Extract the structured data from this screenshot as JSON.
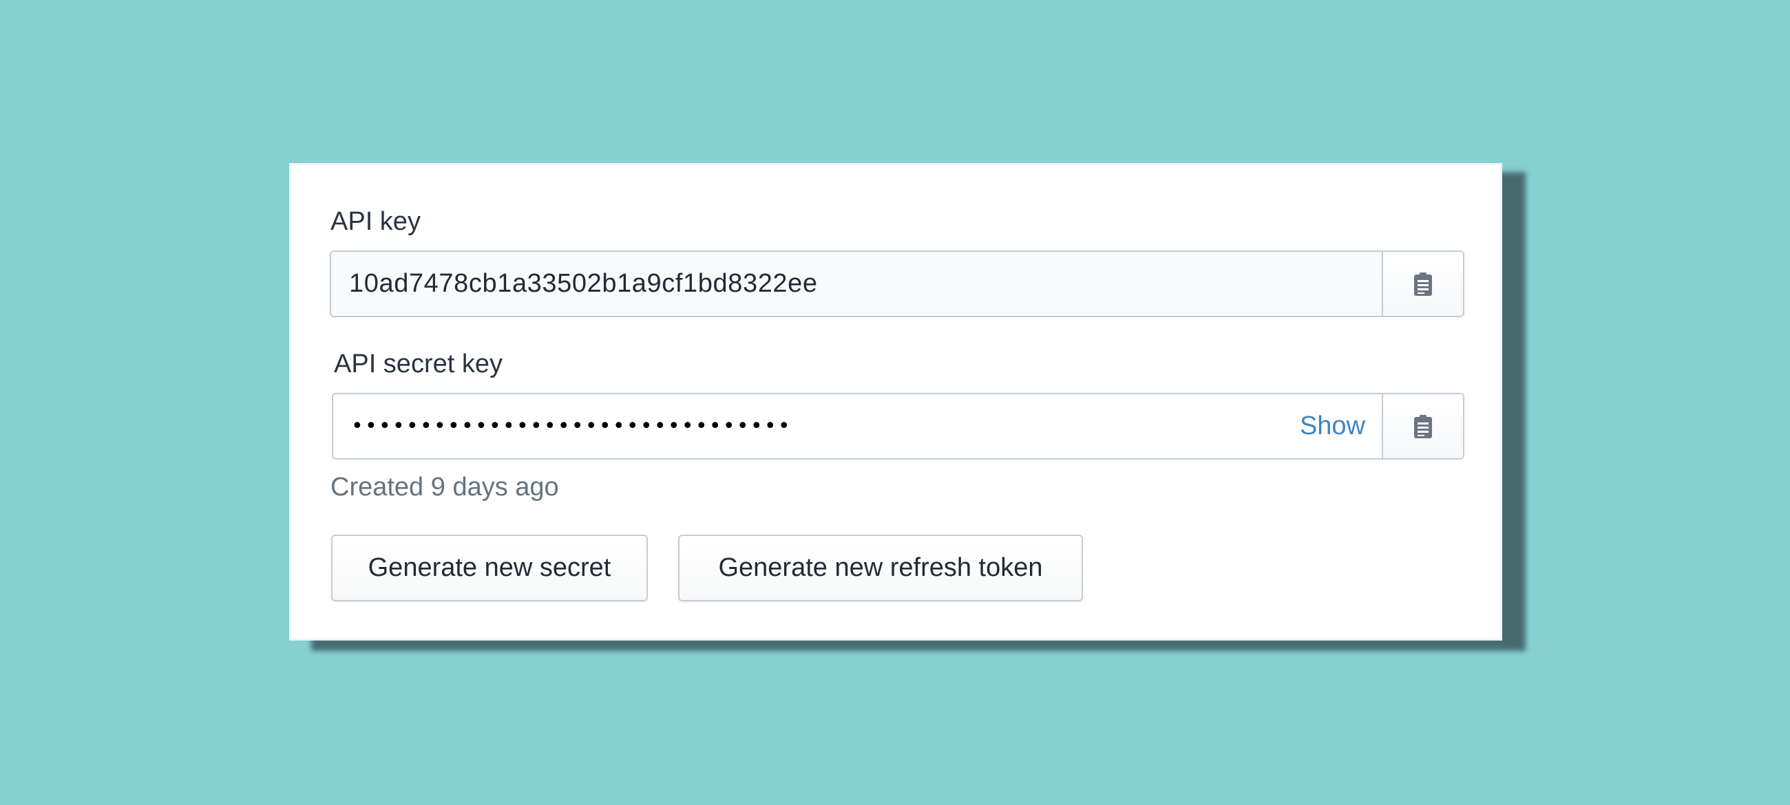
{
  "api_key": {
    "label": "API key",
    "value": "10ad7478cb1a33502b1a9cf1bd8322ee",
    "copy_icon": "clipboard-icon"
  },
  "api_secret": {
    "label": "API secret key",
    "masked_value": "••••••••••••••••••••••••••••••••",
    "show_label": "Show",
    "copy_icon": "clipboard-icon",
    "created": "Created 9 days ago"
  },
  "actions": {
    "generate_secret_label": "Generate new secret",
    "generate_refresh_label": "Generate new refresh token"
  },
  "colors": {
    "background": "#86d0d2",
    "shadow": "#466c6f",
    "link": "#3e86c4",
    "border": "#c4cdd5",
    "icon": "#6b7580"
  }
}
